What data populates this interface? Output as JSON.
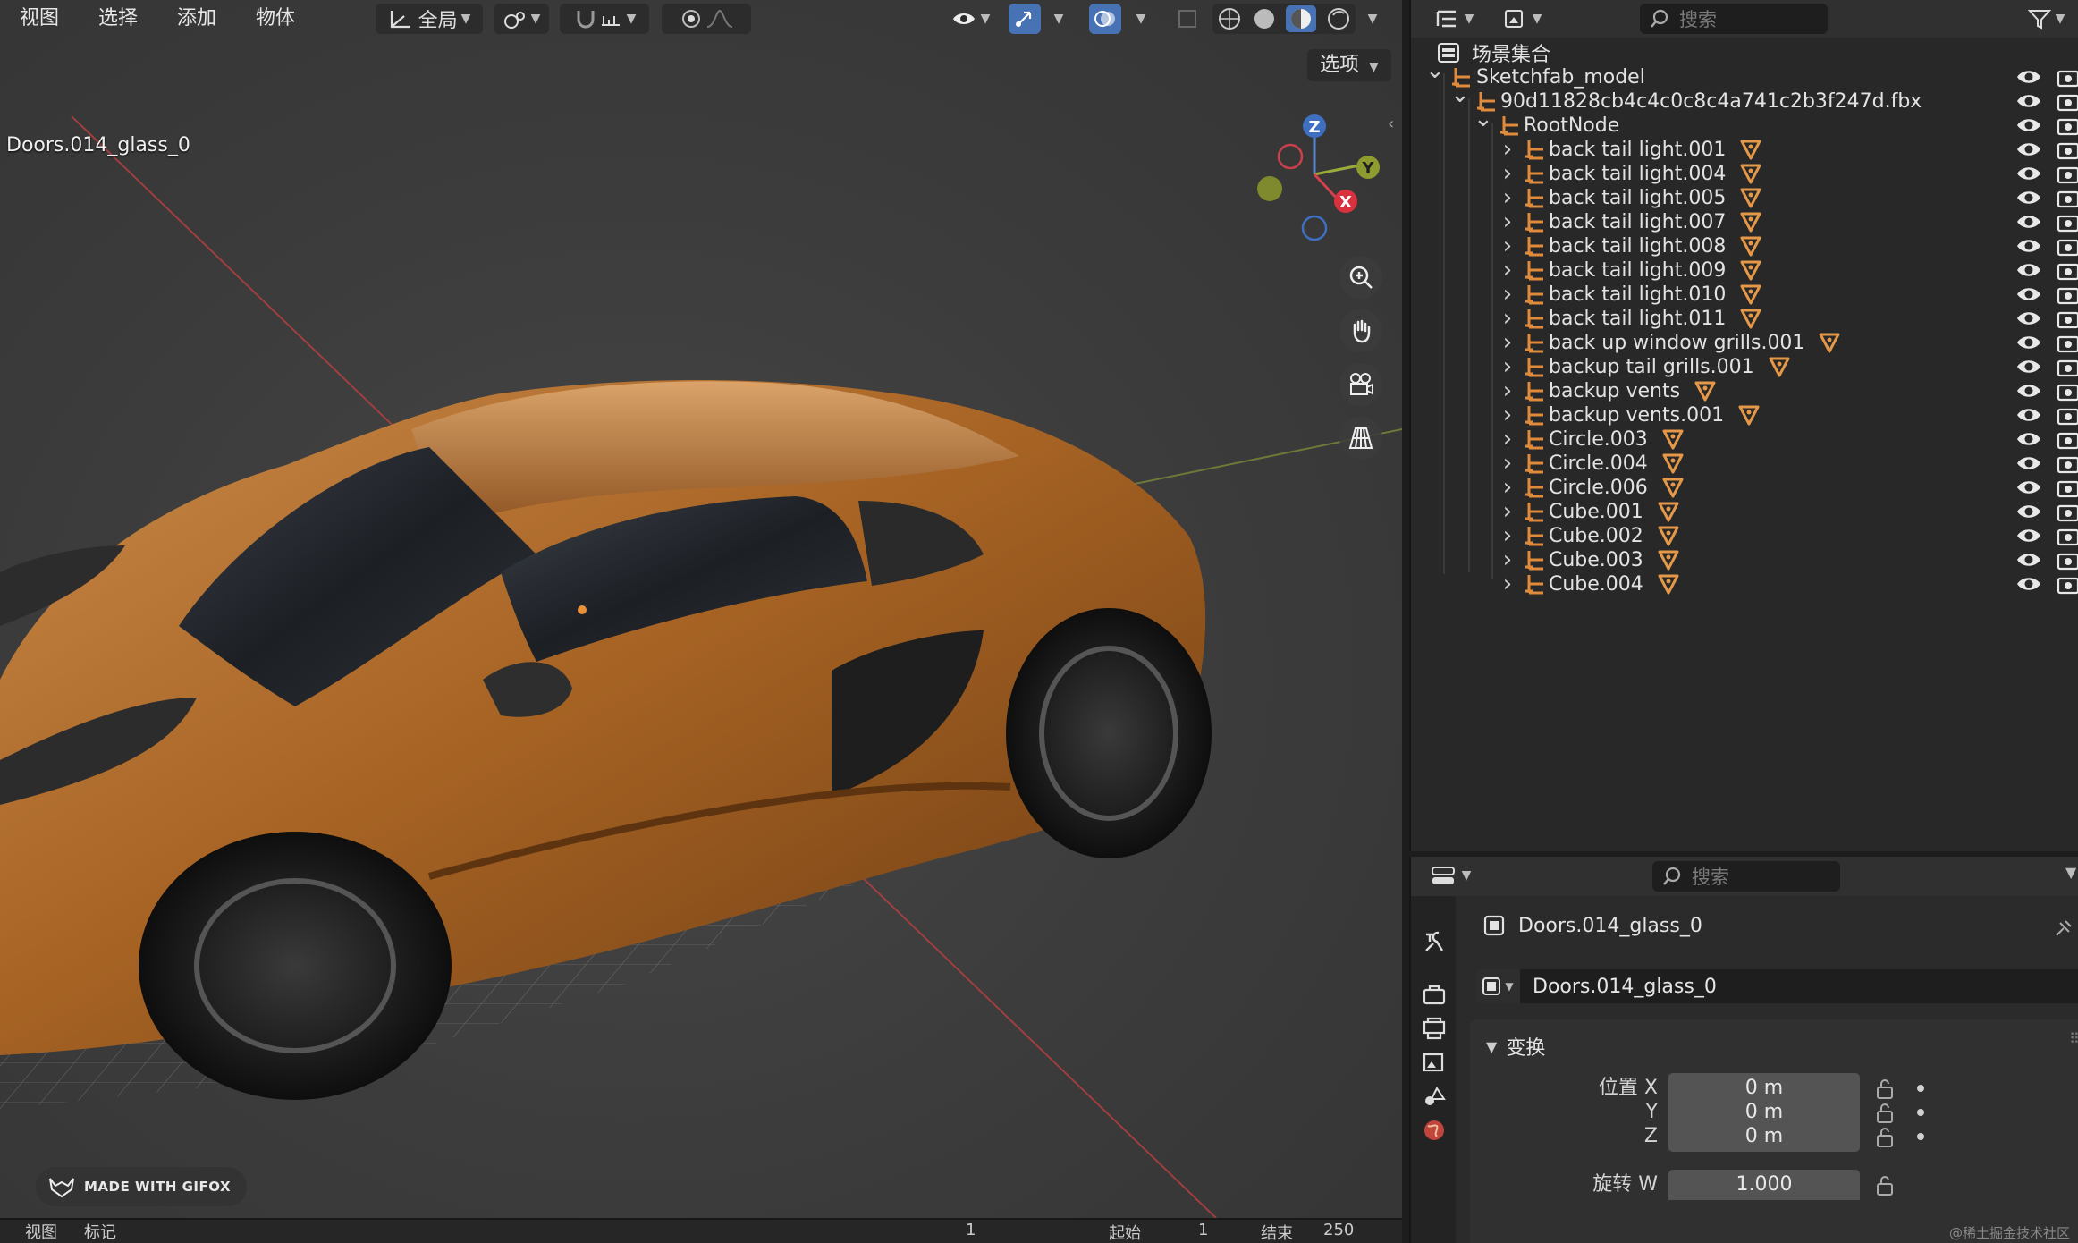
{
  "viewport": {
    "menus": [
      "视图",
      "选择",
      "添加",
      "物体"
    ],
    "transform_orientation": "全局",
    "object_label": "Doors.014_glass_0",
    "options_label": "选项",
    "gizmo": {
      "z": "Z",
      "y": "Y",
      "x": "X"
    }
  },
  "watermark": "MADE WITH GIFOX",
  "timeline": {
    "items": [
      "视图",
      "标记"
    ],
    "frame": "1",
    "start_label": "起始",
    "start": "1",
    "end_label": "结束",
    "end": "250"
  },
  "outliner": {
    "search_placeholder": "搜索",
    "scene_collection": "场景集合",
    "sketchfab_model": "Sketchfab_model",
    "fbx_node": "90d11828cb4c4c0c8c4a741c2b3f247d.fbx",
    "root_node": "RootNode",
    "items": [
      "back tail light.001",
      "back tail light.004",
      "back tail light.005",
      "back tail light.007",
      "back tail light.008",
      "back tail light.009",
      "back tail light.010",
      "back tail light.011",
      "back up window grills.001",
      "backup tail grills.001",
      "backup vents",
      "backup vents.001",
      "Circle.003",
      "Circle.004",
      "Circle.006",
      "Cube.001",
      "Cube.002",
      "Cube.003",
      "Cube.004"
    ]
  },
  "properties": {
    "search_placeholder": "搜索",
    "object_name": "Doors.014_glass_0",
    "name_field": "Doors.014_glass_0",
    "transform_panel": "变换",
    "location_label": "位置 X",
    "axis_y": "Y",
    "axis_z": "Z",
    "loc_x": "0 m",
    "loc_y": "0 m",
    "loc_z": "0 m",
    "rotation_label": "旋转 W",
    "rot_w": "1.000"
  },
  "footer_watermark": "@稀土掘金技术社区",
  "colors": {
    "accent": "#4772b3",
    "object_orange": "#e08a3c",
    "mesh_orange": "#e59848"
  }
}
